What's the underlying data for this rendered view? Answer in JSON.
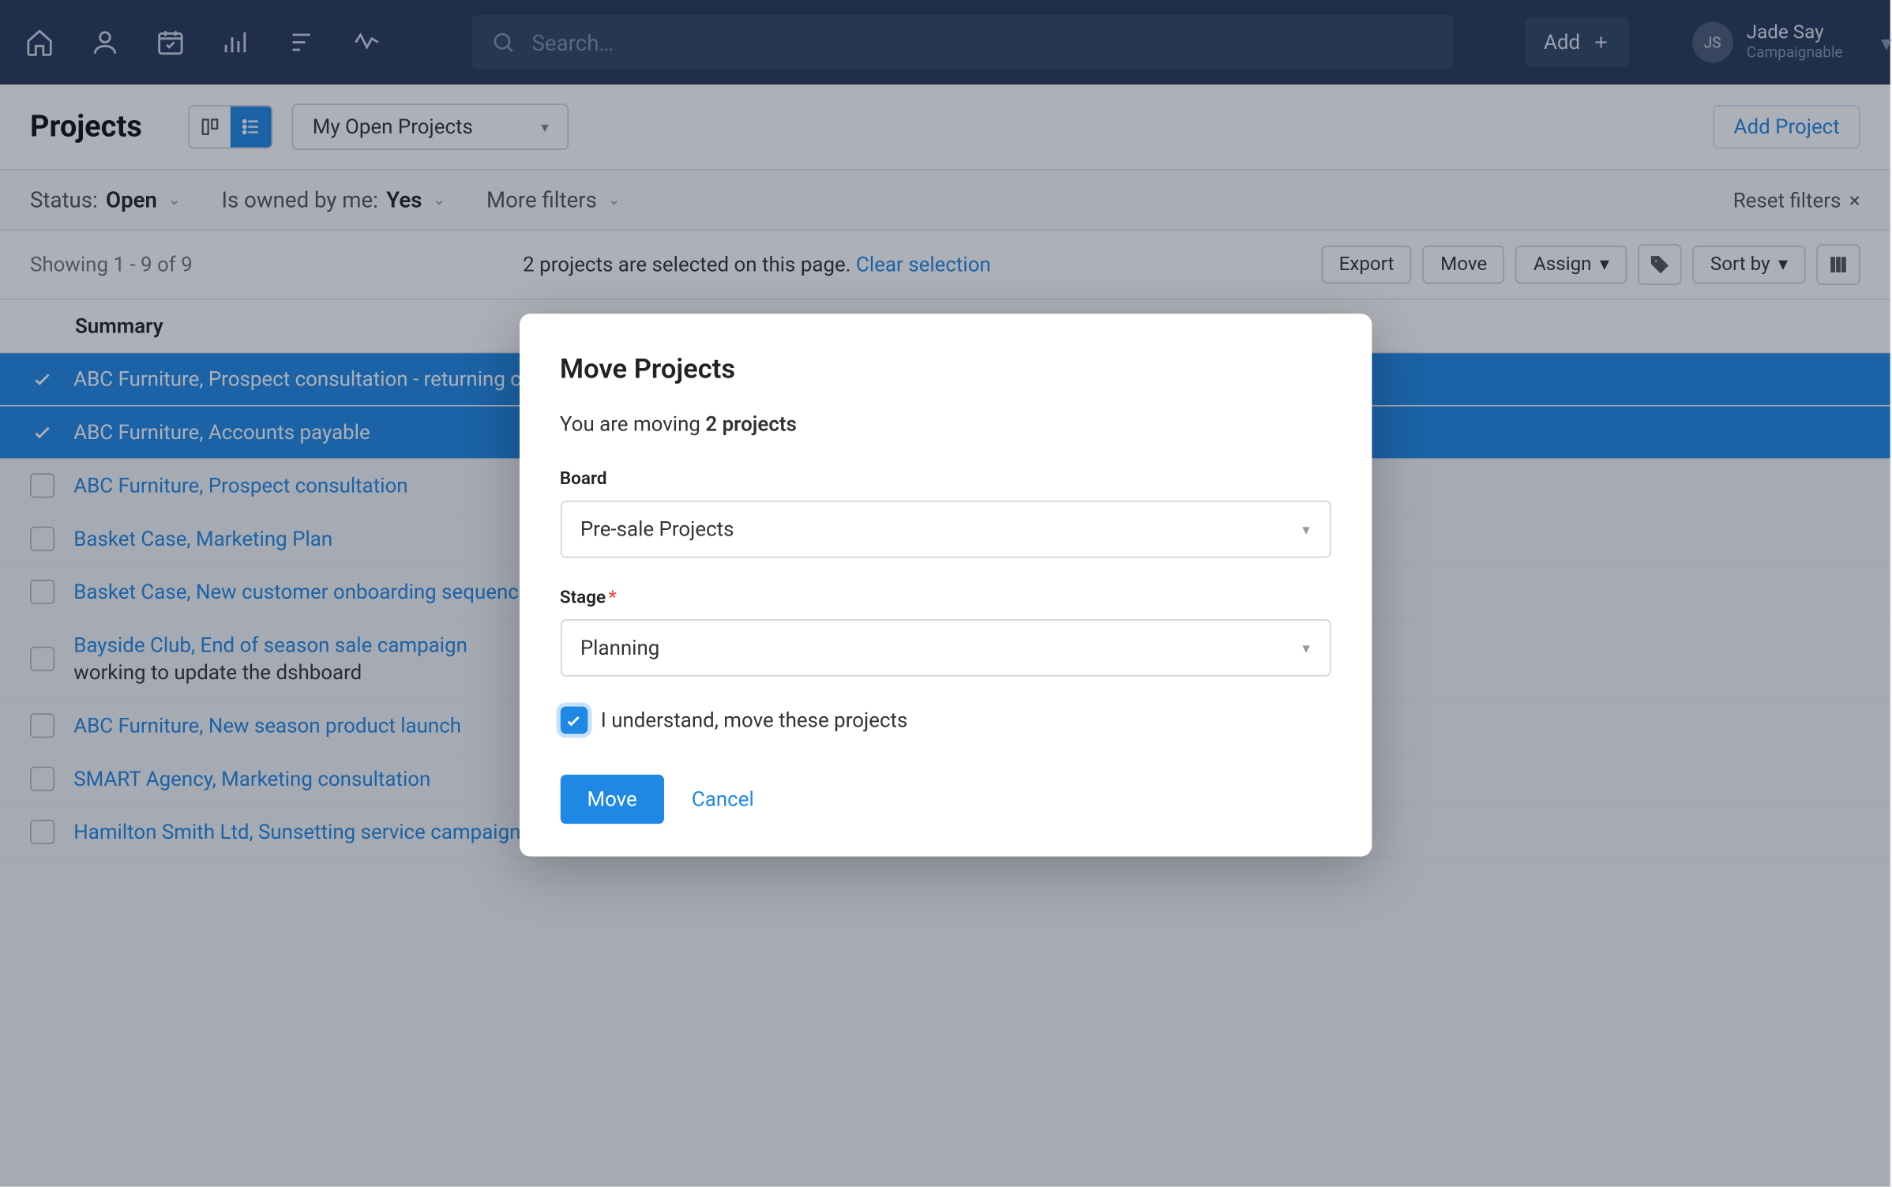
{
  "topnav": {
    "search_placeholder": "Search…",
    "add_label": "Add",
    "user_initials": "JS",
    "user_name": "Jade Say",
    "user_org": "Campaignable"
  },
  "header": {
    "title": "Projects",
    "view_dropdown": "My Open Projects",
    "add_project": "Add Project"
  },
  "filters": {
    "status_label": "Status:",
    "status_value": "Open",
    "owned_label": "Is owned by me:",
    "owned_value": "Yes",
    "more": "More filters",
    "reset": "Reset filters",
    "reset_x": "×"
  },
  "listbar": {
    "showing": "Showing 1 - 9 of 9",
    "selection_pre": "2 projects are selected on this page. ",
    "clear": "Clear selection",
    "export": "Export",
    "move": "Move",
    "assign": "Assign",
    "sort": "Sort by"
  },
  "columns": {
    "summary": "Summary"
  },
  "rows": [
    {
      "selected": true,
      "title": "ABC Furniture, Prospect consultation - returning customer",
      "sub": ""
    },
    {
      "selected": true,
      "title": "ABC Furniture, Accounts payable",
      "sub": ""
    },
    {
      "selected": false,
      "title": "ABC Furniture, Prospect consultation",
      "sub": ""
    },
    {
      "selected": false,
      "title": "Basket Case, Marketing Plan",
      "sub": ""
    },
    {
      "selected": false,
      "title": "Basket Case, New customer onboarding sequence",
      "sub": ""
    },
    {
      "selected": false,
      "title": "Bayside Club, End of season sale campaign",
      "sub": "working to update the dshboard"
    },
    {
      "selected": false,
      "title": "ABC Furniture, New season product launch",
      "sub": ""
    },
    {
      "selected": false,
      "title": "SMART Agency, Marketing consultation",
      "sub": ""
    },
    {
      "selected": false,
      "title": "Hamilton Smith Ltd, Sunsetting service campaign",
      "sub": ""
    }
  ],
  "modal": {
    "title": "Move Projects",
    "intro_pre": "You are moving ",
    "intro_bold": "2 projects",
    "board_label": "Board",
    "board_value": "Pre-sale Projects",
    "stage_label": "Stage",
    "stage_value": "Planning",
    "confirm_label": "I understand, move these projects",
    "move_btn": "Move",
    "cancel_btn": "Cancel"
  }
}
